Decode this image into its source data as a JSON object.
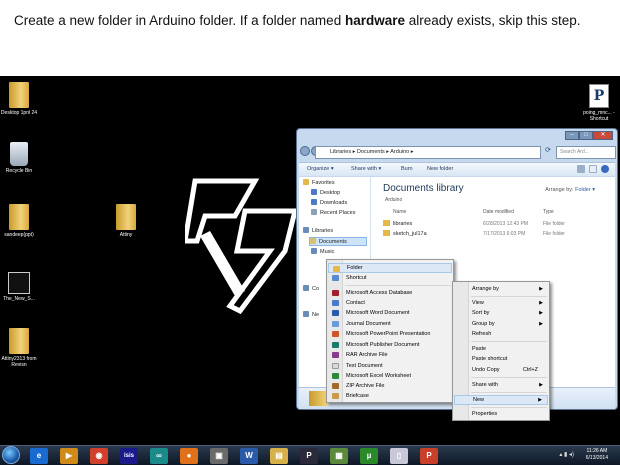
{
  "caption": {
    "part1": "Create a new folder in Arduino folder. If a folder named ",
    "bold": "hardware",
    "part2": " already exists, skip this step."
  },
  "desktop_icons": [
    {
      "label": "Desktop 1pnl 24",
      "type": "folder"
    },
    {
      "label": "Recycle Bin",
      "type": "bin"
    },
    {
      "label": "sandeep(ppt)",
      "type": "folder"
    },
    {
      "label": "The_New_S...",
      "type": "file"
    },
    {
      "label": "Attiny2313 from Revisn",
      "type": "folder"
    },
    {
      "label": "Attiny",
      "type": "folder"
    },
    {
      "label": "poing_mnc... - Shortcut",
      "type": "shortcut"
    }
  ],
  "explorer": {
    "address": "Libraries ▸ Documents ▸ Arduino ▸",
    "search_placeholder": "Search Ard...",
    "toolbar": [
      "Organize ▾",
      "Share with ▾",
      "Burn",
      "New folder"
    ],
    "nav": [
      {
        "label": "Favorites",
        "color": "#e6b84a"
      },
      {
        "label": "Desktop",
        "color": "#4a7ac8"
      },
      {
        "label": "Downloads",
        "color": "#4a7ac8"
      },
      {
        "label": "Recent Places",
        "color": "#8aa0b8"
      },
      {
        "label": "Libraries",
        "color": "#6a8ab8"
      },
      {
        "label": "Documents",
        "color": "#d8c070"
      },
      {
        "label": "Music",
        "color": "#6a8ab8"
      },
      {
        "label": "Co",
        "color": "#6a8ab8"
      },
      {
        "label": "Ne",
        "color": "#6a8ab8"
      }
    ],
    "library_title": "Documents library",
    "library_sub": "Arduino",
    "arrange_by_label": "Arrange by:",
    "arrange_by_value": "Folder ▾",
    "columns": [
      "Name",
      "Date modified",
      "Type"
    ],
    "files": [
      {
        "name": "libraries",
        "date": "6/28/2013 12:43 PM",
        "type": "File folder"
      },
      {
        "name": "sketch_jul17a",
        "date": "7/17/2013 6:03 PM",
        "type": "File folder"
      }
    ]
  },
  "context_menu": {
    "items": [
      {
        "label": "Arrange by",
        "submenu": true
      },
      {
        "label": "View",
        "submenu": true
      },
      {
        "label": "Sort by",
        "submenu": true
      },
      {
        "label": "Group by",
        "submenu": true
      },
      {
        "label": "Refresh"
      },
      {
        "label": "Paste"
      },
      {
        "label": "Paste shortcut"
      },
      {
        "label": "Undo Copy",
        "shortcut": "Ctrl+Z"
      },
      {
        "label": "Share with",
        "submenu": true
      },
      {
        "label": "New",
        "submenu": true,
        "highlighted": true
      },
      {
        "label": "Properties"
      }
    ]
  },
  "new_submenu": {
    "items": [
      {
        "label": "Folder",
        "highlighted": true,
        "color": "#e6b84a"
      },
      {
        "label": "Shortcut",
        "color": "#5a8ad0"
      },
      {
        "label": "Microsoft Access Database",
        "color": "#a02030"
      },
      {
        "label": "Contact",
        "color": "#4a7ac8"
      },
      {
        "label": "Microsoft Word Document",
        "color": "#2a5aa8"
      },
      {
        "label": "Journal Document",
        "color": "#6a9ad8"
      },
      {
        "label": "Microsoft PowerPoint Presentation",
        "color": "#d0542a"
      },
      {
        "label": "Microsoft Publisher Document",
        "color": "#1a7a6a"
      },
      {
        "label": "RAR Archive File",
        "color": "#8a3a8a"
      },
      {
        "label": "Text Document",
        "color": "#d8d8d8"
      },
      {
        "label": "Microsoft Excel Worksheet",
        "color": "#2a8a3a"
      },
      {
        "label": "ZIP Archive File",
        "color": "#a06a2a"
      },
      {
        "label": "Briefcase",
        "color": "#c89a4a"
      }
    ]
  },
  "taskbar": {
    "apps": [
      {
        "name": "internet-explorer",
        "glyph": "e",
        "color": "#1a6ad0"
      },
      {
        "name": "media-player",
        "glyph": "▶",
        "color": "#d08a1a"
      },
      {
        "name": "chrome",
        "glyph": "◉",
        "color": "#d0402a"
      },
      {
        "name": "isis",
        "glyph": "isis",
        "color": "#1a1a8a"
      },
      {
        "name": "arduino",
        "glyph": "∞",
        "color": "#1a8a8a"
      },
      {
        "name": "firefox",
        "glyph": "●",
        "color": "#e0701a"
      },
      {
        "name": "app-box",
        "glyph": "▣",
        "color": "#6a6a6a"
      },
      {
        "name": "word",
        "glyph": "W",
        "color": "#2a5aa8"
      },
      {
        "name": "explorer",
        "glyph": "▤",
        "color": "#d8b04a"
      },
      {
        "name": "pdf-app",
        "glyph": "P",
        "color": "#2a2a3a"
      },
      {
        "name": "utility",
        "glyph": "▦",
        "color": "#5a8a3a"
      },
      {
        "name": "utorrent",
        "glyph": "µ",
        "color": "#2a8a2a"
      },
      {
        "name": "documents",
        "glyph": "▯",
        "color": "#c8c8d8"
      },
      {
        "name": "powerpoint",
        "glyph": "P",
        "color": "#c8402a"
      }
    ],
    "time": "11:26 AM",
    "date": "6/13/2014"
  }
}
